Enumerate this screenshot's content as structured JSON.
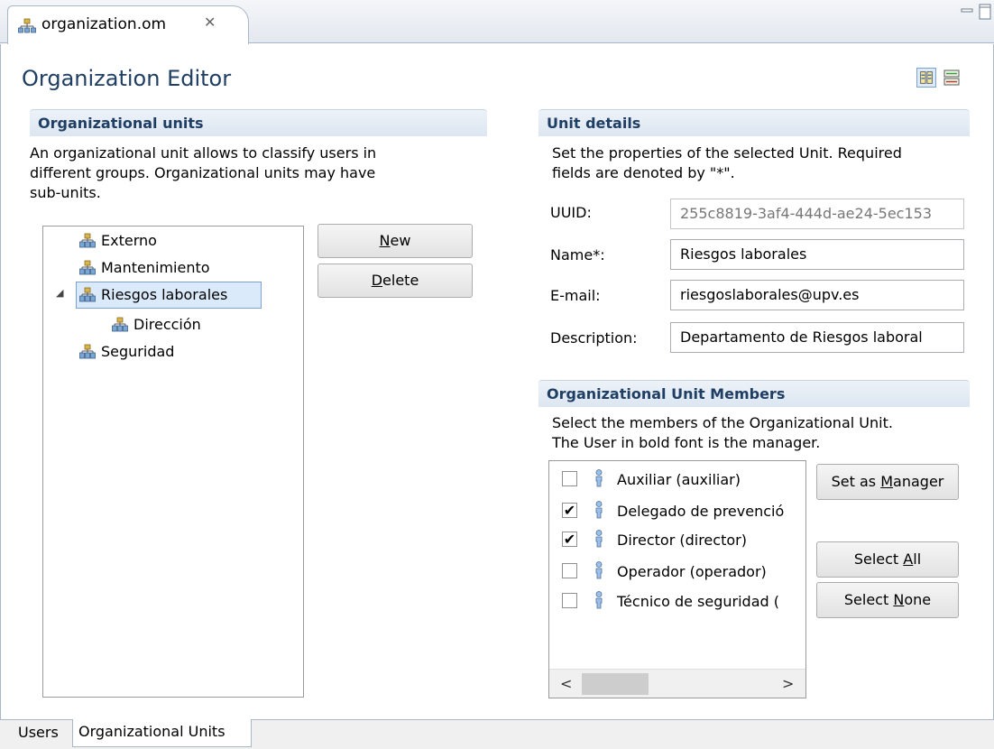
{
  "editor_tab": {
    "label": "organization.om",
    "close_glyph": "✕",
    "icon": "organization-icon"
  },
  "view_controls": {
    "minimize_icon": "minimize-icon",
    "maximize_icon": "maximize-icon"
  },
  "page_title": "Organization Editor",
  "toolbar": {
    "horizontal_layout_icon": "horizontal-layout-icon",
    "vertical_layout_icon": "vertical-layout-icon"
  },
  "org_units": {
    "header": "Organizational units",
    "description_lines": [
      "An organizational unit allows to classify users in",
      "different groups. Organizational units may have",
      "sub-units."
    ],
    "tree": [
      {
        "label": "Externo",
        "level": 0,
        "selected": false
      },
      {
        "label": "Mantenimiento",
        "level": 0,
        "selected": false
      },
      {
        "label": "Riesgos laborales",
        "level": 0,
        "selected": true,
        "expanded": true
      },
      {
        "label": "Dirección",
        "level": 1,
        "selected": false
      },
      {
        "label": "Seguridad",
        "level": 0,
        "selected": false
      }
    ],
    "new_button": {
      "mnemonic": "N",
      "rest": "ew"
    },
    "delete_button": {
      "mnemonic": "D",
      "rest": "elete"
    }
  },
  "unit_details": {
    "header": "Unit details",
    "description_lines": [
      "Set the properties of the selected Unit. Required",
      "fields are denoted by \"*\"."
    ],
    "uuid_label": "UUID:",
    "uuid_value": "255c8819-3af4-444d-ae24-5ec153",
    "name_label": "Name*:",
    "name_value": "Riesgos laborales",
    "email_label": "E-mail:",
    "email_value": "riesgoslaborales@upv.es",
    "description_label": "Description:",
    "description_value": "Departamento de Riesgos laboral"
  },
  "members": {
    "header": "Organizational Unit Members",
    "description_lines": [
      "Select the members of the Organizational Unit.",
      "The User in bold font is the manager."
    ],
    "items": [
      {
        "label": "Auxiliar (auxiliar)",
        "checked": false
      },
      {
        "label": "Delegado de prevenció",
        "checked": true
      },
      {
        "label": "Director (director)",
        "checked": true
      },
      {
        "label": "Operador (operador)",
        "checked": false
      },
      {
        "label": "Técnico de seguridad (",
        "checked": false
      }
    ],
    "set_manager": {
      "before": "Set as ",
      "mnemonic": "M",
      "after": "anager"
    },
    "select_all": {
      "before": "Select ",
      "mnemonic": "A",
      "after": "ll"
    },
    "select_none": {
      "before": "Select ",
      "mnemonic": "N",
      "after": "one"
    },
    "scroll_left": "<",
    "scroll_right": ">"
  },
  "bottom_tabs": {
    "users": "Users",
    "org_units": "Organizational Units"
  }
}
